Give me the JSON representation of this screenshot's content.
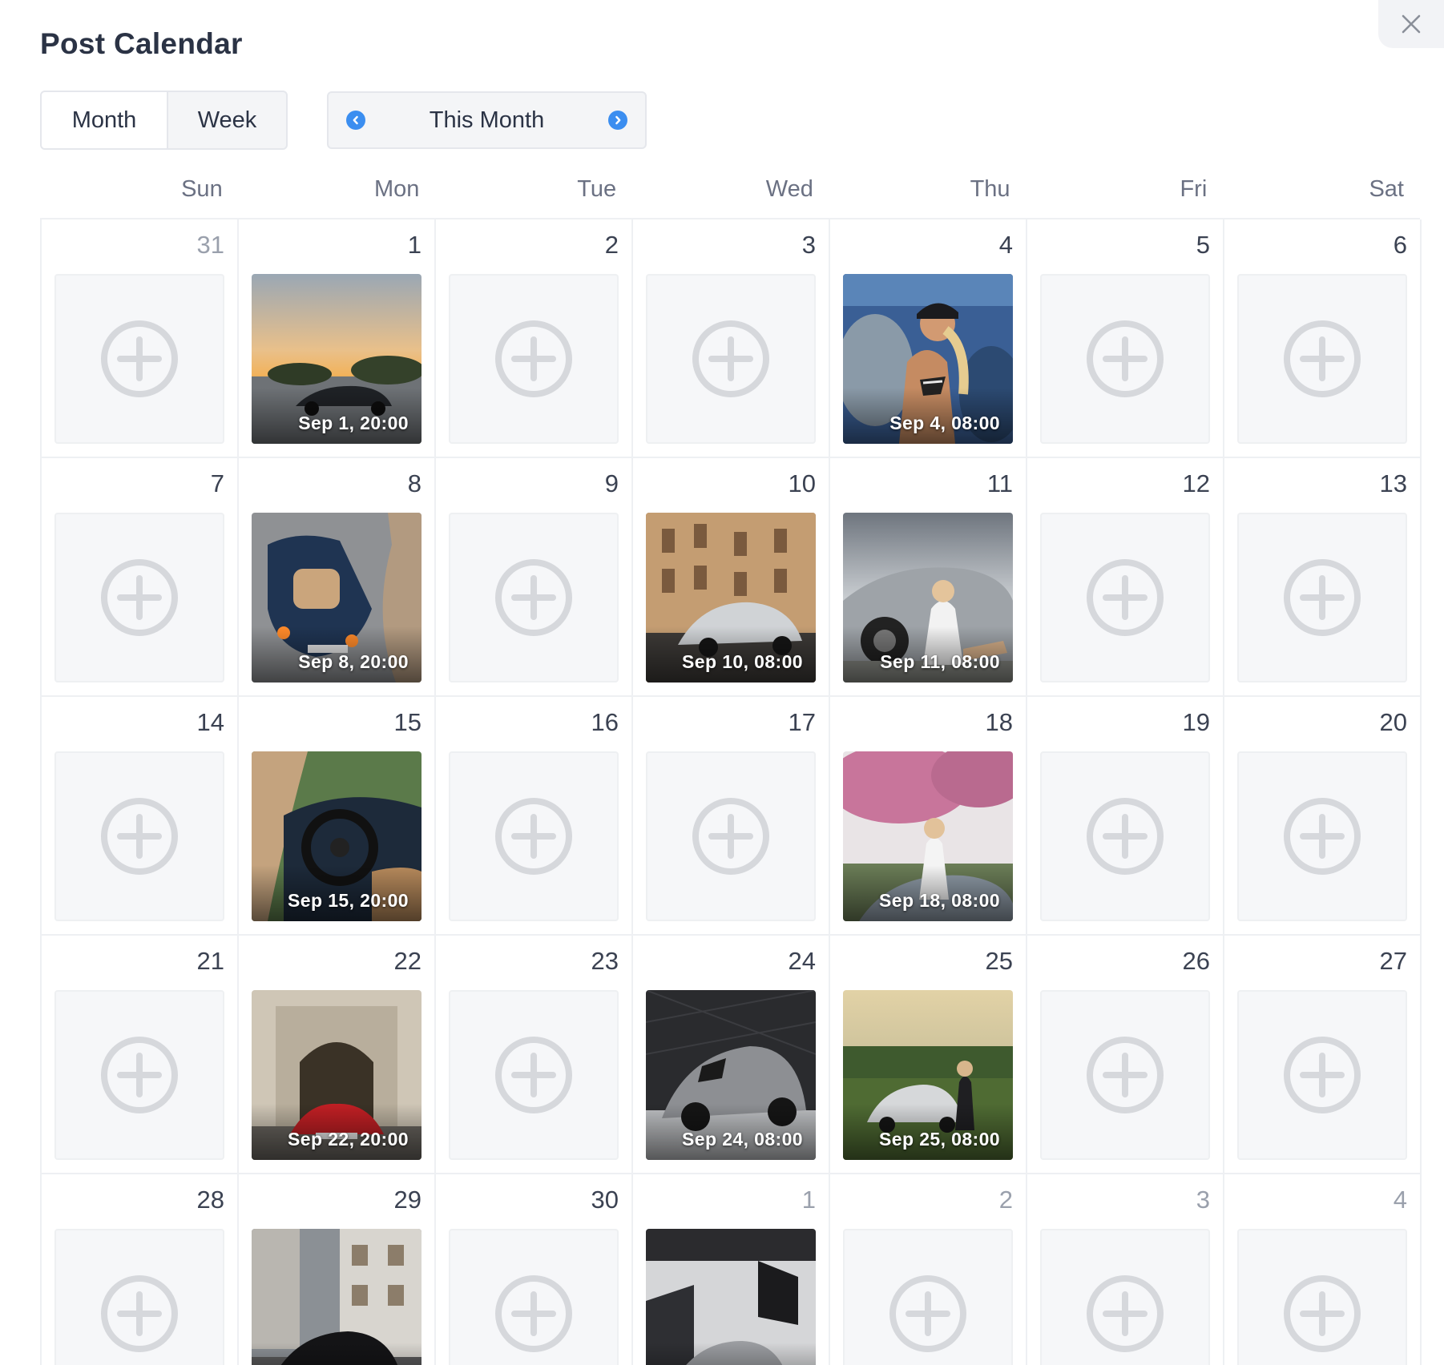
{
  "dialog": {
    "title": "Post Calendar",
    "close_icon": "close-icon"
  },
  "view_toggle": {
    "month_label": "Month",
    "week_label": "Week",
    "selected": "Month"
  },
  "period_nav": {
    "label": "This Month",
    "prev_icon": "chevron-left-circle-icon",
    "next_icon": "chevron-right-circle-icon",
    "accent_color": "#3b8ef0"
  },
  "weekdays": [
    "Sun",
    "Mon",
    "Tue",
    "Wed",
    "Thu",
    "Fri",
    "Sat"
  ],
  "weeks": [
    [
      {
        "day": "31",
        "other": true
      },
      {
        "day": "1",
        "post": {
          "time": "Sep 1, 20:00",
          "scene": "sunset-parking-car"
        }
      },
      {
        "day": "2"
      },
      {
        "day": "3"
      },
      {
        "day": "4",
        "post": {
          "time": "Sep 4, 08:00",
          "scene": "woman-cap-bikini"
        }
      },
      {
        "day": "5"
      },
      {
        "day": "6"
      }
    ],
    [
      {
        "day": "7"
      },
      {
        "day": "8",
        "post": {
          "time": "Sep 8, 20:00",
          "scene": "blue-convertible-top"
        }
      },
      {
        "day": "9"
      },
      {
        "day": "10",
        "post": {
          "time": "Sep 10, 08:00",
          "scene": "silver-car-old-street"
        }
      },
      {
        "day": "11",
        "post": {
          "time": "Sep 11, 08:00",
          "scene": "woman-silver-car-cloudy"
        }
      },
      {
        "day": "12"
      },
      {
        "day": "13"
      }
    ],
    [
      {
        "day": "14"
      },
      {
        "day": "15",
        "post": {
          "time": "Sep 15, 20:00",
          "scene": "convertible-interior"
        }
      },
      {
        "day": "16"
      },
      {
        "day": "17"
      },
      {
        "day": "18",
        "post": {
          "time": "Sep 18, 08:00",
          "scene": "woman-blossom-tree-car"
        }
      },
      {
        "day": "19"
      },
      {
        "day": "20"
      }
    ],
    [
      {
        "day": "21"
      },
      {
        "day": "22",
        "post": {
          "time": "Sep 22, 20:00",
          "scene": "red-car-archway"
        }
      },
      {
        "day": "23"
      },
      {
        "day": "24",
        "post": {
          "time": "Sep 24, 08:00",
          "scene": "grey-porsche-studio"
        }
      },
      {
        "day": "25",
        "post": {
          "time": "Sep 25, 08:00",
          "scene": "woman-small-car-field"
        }
      },
      {
        "day": "26"
      },
      {
        "day": "27"
      }
    ],
    [
      {
        "day": "28"
      },
      {
        "day": "29",
        "post": {
          "time": "",
          "scene": "black-car-street"
        }
      },
      {
        "day": "30"
      },
      {
        "day": "1",
        "other": true,
        "post": {
          "time": "",
          "scene": "race-car-garage"
        }
      },
      {
        "day": "2",
        "other": true
      },
      {
        "day": "3",
        "other": true
      },
      {
        "day": "4",
        "other": true
      }
    ]
  ],
  "add_slot_icon": "plus-circle-icon"
}
